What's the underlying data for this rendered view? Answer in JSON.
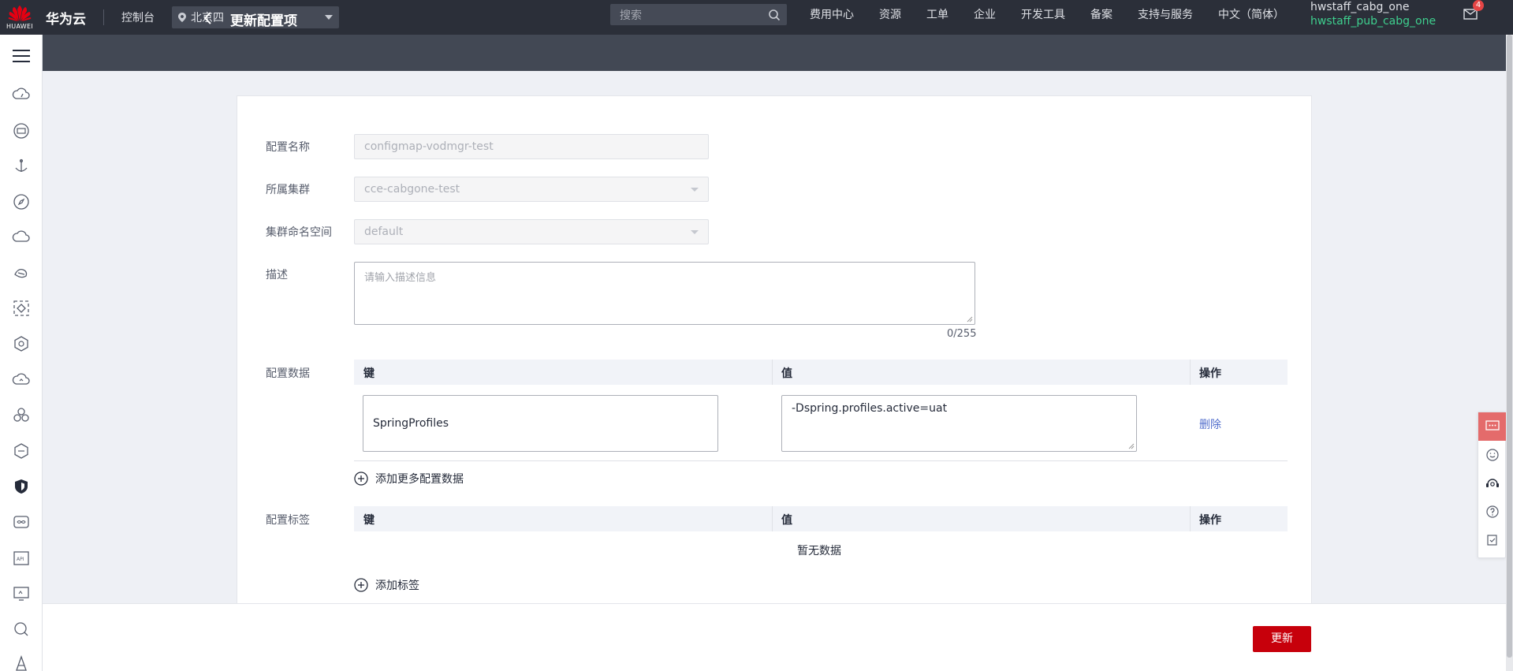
{
  "topbar": {
    "logo_text": "HUAWEI",
    "brand": "华为云",
    "console": "控制台",
    "region": "北京四",
    "search_placeholder": "搜索",
    "nav": [
      "费用中心",
      "资源",
      "工单",
      "企业",
      "开发工具",
      "备案",
      "支持与服务",
      "中文（简体）"
    ],
    "user_name": "hwstaff_cabg_one",
    "user_sub": "hwstaff_pub_cabg_one",
    "mail_count": "4"
  },
  "page": {
    "title": "更新配置项"
  },
  "form": {
    "name_label": "配置名称",
    "name_value": "configmap-vodmgr-test",
    "cluster_label": "所属集群",
    "cluster_value": "cce-cabgone-test",
    "namespace_label": "集群命名空间",
    "namespace_value": "default",
    "desc_label": "描述",
    "desc_placeholder": "请输入描述信息",
    "desc_counter": "0/255",
    "data_label": "配置数据",
    "data_table": {
      "headers": [
        "键",
        "值",
        "操作"
      ],
      "rows": [
        {
          "key": "SpringProfiles",
          "value": "-Dspring.profiles.active=uat",
          "action": "删除"
        }
      ]
    },
    "add_data": "添加更多配置数据",
    "tag_label": "配置标签",
    "tag_table": {
      "headers": [
        "键",
        "值",
        "操作"
      ],
      "empty": "暂无数据"
    },
    "add_tag": "添加标签"
  },
  "footer": {
    "update_button": "更新"
  },
  "colors": {
    "primary_red": "#c7000b",
    "topbar": "#2b2f39",
    "link_blue": "#526ecc",
    "user_sub_green": "#3ecf8e"
  }
}
